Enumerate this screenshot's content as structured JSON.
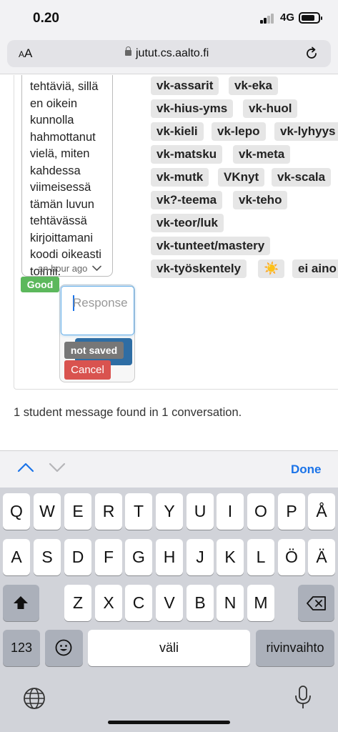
{
  "status_bar": {
    "time": "0.20",
    "network": "4G"
  },
  "browser": {
    "text_size_label": "AA",
    "url": "jutut.cs.aalto.fi"
  },
  "message": {
    "lines": [
      "tehtäviä, sillä",
      "en oikein",
      "kunnolla",
      "hahmottanut",
      "vielä, miten",
      "kahdessa",
      "viimeisessä",
      "tämän luvun",
      "tehtävässä",
      "kirjoittamani",
      "koodi oikeasti",
      "toimii."
    ],
    "timestamp": "an hour ago"
  },
  "grade_badge": "Good",
  "response": {
    "placeholder": "Response",
    "save_status": "not saved",
    "cancel_label": "Cancel"
  },
  "tags": [
    "vk-assarit",
    "vk-eka",
    "vk-hius-yms",
    "vk-huol",
    "vk-kieli",
    "vk-lepo",
    "vk-lyhyys",
    "vk-matsku",
    "vk-meta",
    "vk-mutk",
    "VKnyt",
    "vk-scala",
    "vk?-teema",
    "vk-teho",
    "vk-teor/luk",
    "vk-tunteet/mastery",
    "vk-työskentely",
    "☀️",
    "ei aino"
  ],
  "summary": "1 student message found in 1 conversation.",
  "keyboard": {
    "done_label": "Done",
    "row1": [
      "Q",
      "W",
      "E",
      "R",
      "T",
      "Y",
      "U",
      "I",
      "O",
      "P",
      "Å"
    ],
    "row2": [
      "A",
      "S",
      "D",
      "F",
      "G",
      "H",
      "J",
      "K",
      "L",
      "Ö",
      "Ä"
    ],
    "row3": [
      "Z",
      "X",
      "C",
      "V",
      "B",
      "N",
      "M"
    ],
    "numbers_label": "123",
    "space_label": "väli",
    "return_label": "rivinvaihto"
  },
  "colors": {
    "accent": "#1a73e8",
    "good": "#5cb85c",
    "cancel": "#d9534f",
    "save": "#2e6da4"
  }
}
